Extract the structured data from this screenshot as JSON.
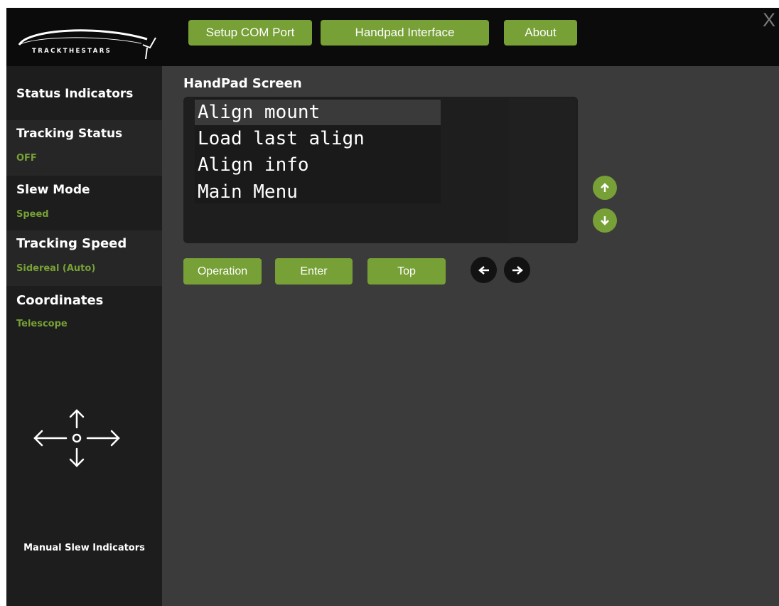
{
  "app": {
    "logo_text": "TRACKTHESTARS",
    "close_label": "X"
  },
  "nav": [
    {
      "label": "Setup COM Port"
    },
    {
      "label": "Handpad Interface"
    },
    {
      "label": "About"
    }
  ],
  "sidebar": {
    "status_indicators_title": "Status Indicators",
    "tracking_status": {
      "label": "Tracking Status",
      "value": "OFF"
    },
    "slew_mode": {
      "label": "Slew Mode",
      "value": "Speed"
    },
    "tracking_speed": {
      "label": "Tracking Speed",
      "value": "Sidereal (Auto)"
    },
    "coordinates": {
      "label": "Coordinates",
      "value": "Telescope"
    },
    "manual_slew_label": "Manual Slew Indicators"
  },
  "handpad": {
    "title": "HandPad Screen",
    "lines": [
      "Align mount",
      "Load last align",
      "Align info",
      "Main Menu"
    ],
    "selected_index": 0
  },
  "buttons": {
    "operation": "Operation",
    "enter": "Enter",
    "top": "Top"
  },
  "icons": {
    "scroll_up": "arrow-up-icon",
    "scroll_down": "arrow-down-icon",
    "left": "arrow-left-icon",
    "right": "arrow-right-icon"
  },
  "colors": {
    "accent": "#77a036",
    "background": "#3b3b3b",
    "sidebar": "#1d1d1d",
    "topbar": "#0b0b0b"
  }
}
